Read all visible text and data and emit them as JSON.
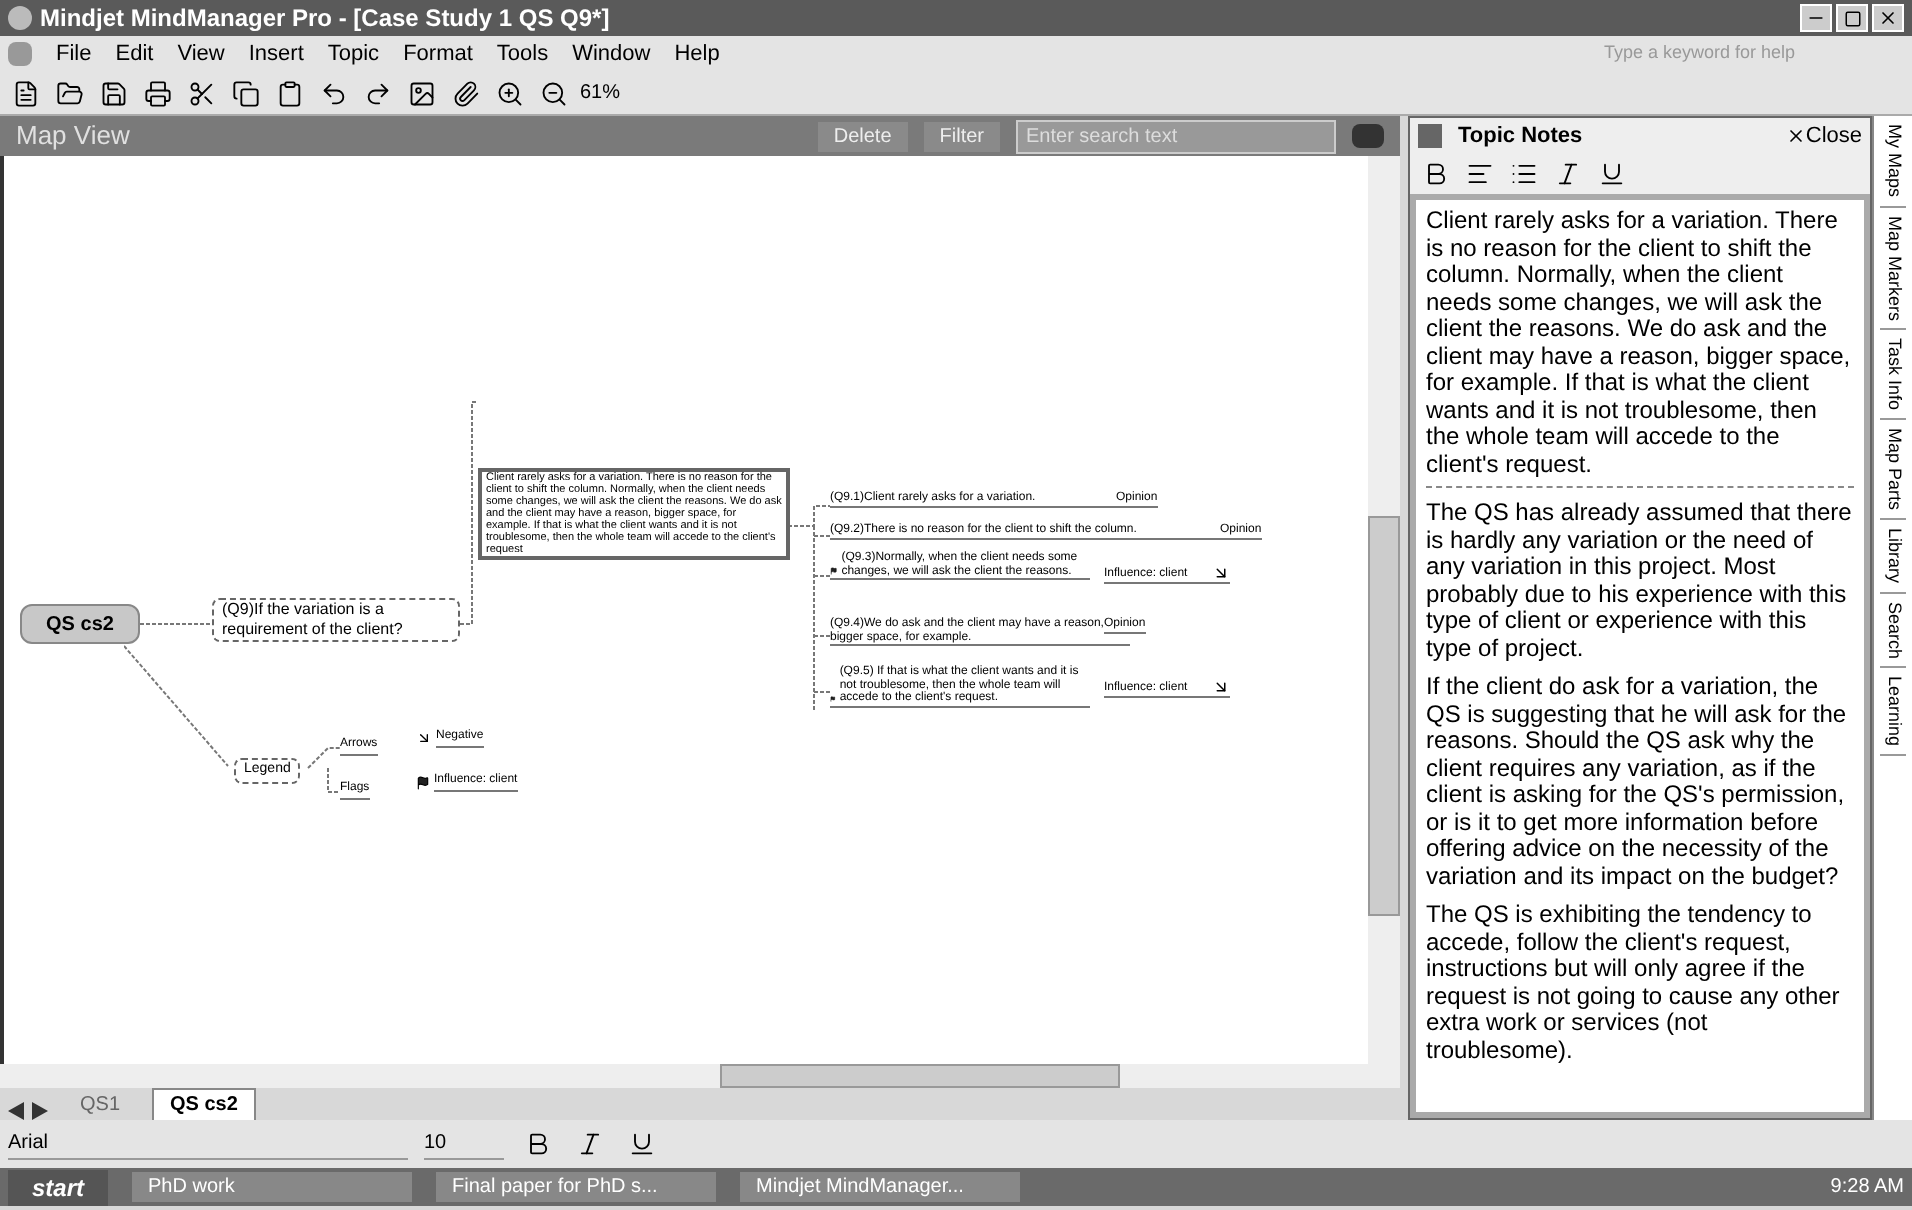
{
  "window": {
    "title": "Mindjet MindManager Pro - [Case Study 1 QS Q9*]"
  },
  "menu": [
    "File",
    "Edit",
    "View",
    "Insert",
    "Topic",
    "Format",
    "Tools",
    "Window",
    "Help"
  ],
  "help_search": {
    "placeholder": "Type a keyword for help"
  },
  "toolbar": {
    "zoom": "61%"
  },
  "map_view": {
    "title": "Map View",
    "buttons": [
      "Delete",
      "Filter"
    ],
    "search": {
      "placeholder": "Enter search text"
    }
  },
  "map": {
    "central": "QS cs2",
    "main_topic": "(Q9)If the variation is a requirement of the client?",
    "note": "Client rarely asks for a variation. There is no reason for the client to shift the column. Normally, when the client needs some changes, we will ask the client the reasons. We do ask and the client may have a reason, bigger space, for example. If that is what the client wants and it is not troublesome, then the whole team will accede to the client's request",
    "subtopics": [
      {
        "text": "(Q9.1)Client rarely asks for a variation.",
        "label": "Opinion",
        "flagged": false,
        "negative": false
      },
      {
        "text": "(Q9.2)There is no reason for the client to shift the column.",
        "label": "Opinion",
        "flagged": false,
        "negative": false
      },
      {
        "text": "(Q9.3)Normally, when the client needs some changes, we will ask the client the reasons.",
        "label": "Influence: client",
        "flagged": true,
        "negative": true
      },
      {
        "text": "(Q9.4)We do ask and the client may have a reason, bigger space, for example.",
        "label": "Opinion",
        "flagged": false,
        "negative": false
      },
      {
        "text": "(Q9.5) If that is what the client wants and it is not troublesome, then the whole team will accede to the client's request.",
        "label": "Influence: client",
        "flagged": true,
        "negative": true
      }
    ],
    "legend": {
      "title": "Legend",
      "groups": [
        {
          "name": "Arrows",
          "item": "Negative",
          "kind": "arrow"
        },
        {
          "name": "Flags",
          "item": "Influence: client",
          "kind": "flag"
        }
      ]
    }
  },
  "notes": {
    "title": "Topic Notes",
    "close": "Close",
    "paragraphs": [
      "Client rarely asks for a variation. There is no reason for the client to shift the column. Normally, when the client needs some changes, we will ask the client the reasons. We do ask and the client may have a reason, bigger space, for example. If that is what the client wants and it is not troublesome, then the whole team will accede to the client's request.",
      "The QS has already assumed that there is hardly any variation or the need of any variation in this project. Most probably due to his experience with this type of client or experience with this type of project.",
      "If the client do ask for a variation, the QS is suggesting that he will ask for the reasons. Should the QS ask why the client requires any variation, as if the client is asking for the QS's permission, or is it to get more information before offering advice on the necessity of the variation and its impact on the budget?",
      "The QS is exhibiting the tendency to accede, follow the client's request, instructions but will only agree if the request is not going to cause any other extra work or services (not troublesome)."
    ]
  },
  "side_tabs": [
    "My Maps",
    "Map Markers",
    "Task Info",
    "Map Parts",
    "Library",
    "Search",
    "Learning"
  ],
  "map_tabs": [
    {
      "label": "QS1",
      "selected": false
    },
    {
      "label": "QS cs2",
      "selected": true
    }
  ],
  "format_bar": {
    "font": "Arial",
    "size": "10"
  },
  "taskbar": {
    "start": "start",
    "tasks": [
      "PhD work",
      "Final paper for PhD s...",
      "Mindjet MindManager..."
    ],
    "time": "9:28 AM"
  }
}
